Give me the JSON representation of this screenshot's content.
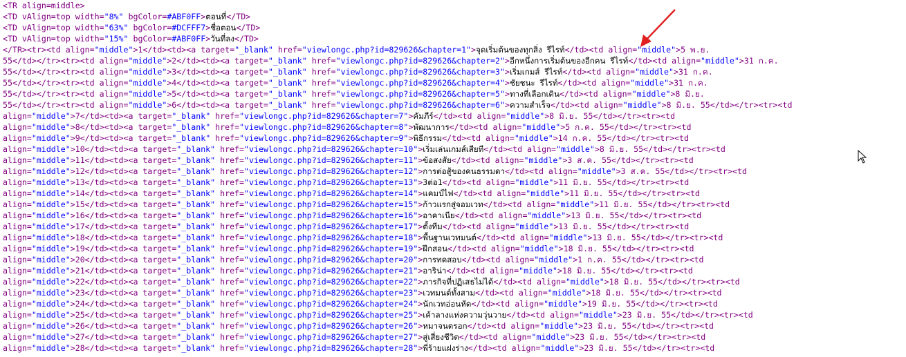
{
  "header_lines": [
    [
      [
        "t",
        "<TR align=middle>"
      ]
    ],
    [
      [
        "t",
        "<TD vAlign=top width="
      ],
      [
        "v",
        "\"8%\""
      ],
      [
        "t",
        " bgColor="
      ],
      [
        "v",
        "#ABF0FF"
      ],
      [
        "t",
        ">"
      ],
      [
        "x",
        "ตอนที่"
      ],
      [
        "t",
        "</TD>"
      ]
    ],
    [
      [
        "t",
        "<TD vAlign=top width="
      ],
      [
        "v",
        "\"63%\""
      ],
      [
        "t",
        " bgColor="
      ],
      [
        "v",
        "#DCFFF7"
      ],
      [
        "t",
        ">"
      ],
      [
        "x",
        "ชื่อตอน"
      ],
      [
        "t",
        "</TD>"
      ]
    ],
    [
      [
        "t",
        "<TD vAlign=top width="
      ],
      [
        "v",
        "\"15%\""
      ],
      [
        "t",
        " bgColor="
      ],
      [
        "v",
        "#ABF0FF"
      ],
      [
        "t",
        ">"
      ],
      [
        "x",
        "วันที่ลง"
      ],
      [
        "t",
        "</TD>"
      ]
    ]
  ],
  "body_lines": [
    [
      [
        "t",
        "</TR><tr><td align="
      ],
      [
        "v",
        "\"middle\""
      ],
      [
        "t",
        ">1</td><td><a target="
      ],
      [
        "v",
        "\"_blank\""
      ],
      [
        "t",
        " href="
      ],
      [
        "v",
        "\"viewlongc.php?id=829626&chapter=1\""
      ],
      [
        "t",
        ">"
      ],
      [
        "x",
        "จุดเริ่มต้นของทุกสิ่ง รีไรท์"
      ],
      [
        "t",
        "</td><td align="
      ],
      [
        "v",
        "\"middle\""
      ],
      [
        "t",
        ">5 พ.ย."
      ]
    ],
    [
      [
        "t",
        "55</td></tr><tr><td align="
      ],
      [
        "v",
        "\"middle\""
      ],
      [
        "t",
        ">2</td><td><a target="
      ],
      [
        "v",
        "\"_blank\""
      ],
      [
        "t",
        " href="
      ],
      [
        "v",
        "\"viewlongc.php?id=829626&chapter=2\""
      ],
      [
        "t",
        ">"
      ],
      [
        "x",
        "อีกหนึ่งการเริ่มต้นของอีกคน รีไรท์"
      ],
      [
        "t",
        "</td><td align="
      ],
      [
        "v",
        "\"middle\""
      ],
      [
        "t",
        ">31 ก.ค."
      ]
    ],
    [
      [
        "t",
        "55</td></tr><tr><td align="
      ],
      [
        "v",
        "\"middle\""
      ],
      [
        "t",
        ">3</td><td><a target="
      ],
      [
        "v",
        "\"_blank\""
      ],
      [
        "t",
        " href="
      ],
      [
        "v",
        "\"viewlongc.php?id=829626&chapter=3\""
      ],
      [
        "t",
        ">"
      ],
      [
        "x",
        "เริ่มเกมส์ รีไรท์"
      ],
      [
        "t",
        "</td><td align="
      ],
      [
        "v",
        "\"middle\""
      ],
      [
        "t",
        ">31 ก.ค."
      ]
    ],
    [
      [
        "t",
        "55</td></tr><tr><td align="
      ],
      [
        "v",
        "\"middle\""
      ],
      [
        "t",
        ">4</td><td><a target="
      ],
      [
        "v",
        "\"_blank\""
      ],
      [
        "t",
        " href="
      ],
      [
        "v",
        "\"viewlongc.php?id=829626&chapter=4\""
      ],
      [
        "t",
        ">"
      ],
      [
        "x",
        "ชัยชนะ รีไรท์"
      ],
      [
        "t",
        "</td><td align="
      ],
      [
        "v",
        "\"middle\""
      ],
      [
        "t",
        ">31 ก.ค."
      ]
    ],
    [
      [
        "t",
        "55</td></tr><tr><td align="
      ],
      [
        "v",
        "\"middle\""
      ],
      [
        "t",
        ">5</td><td><a target="
      ],
      [
        "v",
        "\"_blank\""
      ],
      [
        "t",
        " href="
      ],
      [
        "v",
        "\"viewlongc.php?id=829626&chapter=5\""
      ],
      [
        "t",
        ">"
      ],
      [
        "x",
        "ทางที่เลือกเดิน"
      ],
      [
        "t",
        "</td><td align="
      ],
      [
        "v",
        "\"middle\""
      ],
      [
        "t",
        ">8 มิ.ย."
      ]
    ],
    [
      [
        "t",
        "55</td></tr><tr><td align="
      ],
      [
        "v",
        "\"middle\""
      ],
      [
        "t",
        ">6</td><td><a target="
      ],
      [
        "v",
        "\"_blank\""
      ],
      [
        "t",
        " href="
      ],
      [
        "v",
        "\"viewlongc.php?id=829626&chapter=6\""
      ],
      [
        "t",
        ">"
      ],
      [
        "x",
        "ความสำเร็จ"
      ],
      [
        "t",
        "</td><td align="
      ],
      [
        "v",
        "\"middle\""
      ],
      [
        "t",
        ">8 มิ.ย. 55</td></tr><tr><td"
      ]
    ],
    [
      [
        "t",
        "align="
      ],
      [
        "v",
        "\"middle\""
      ],
      [
        "t",
        ">7</td><td><a target="
      ],
      [
        "v",
        "\"_blank\""
      ],
      [
        "t",
        " href="
      ],
      [
        "v",
        "\"viewlongc.php?id=829626&chapter=7\""
      ],
      [
        "t",
        ">"
      ],
      [
        "x",
        "คัมภีร์"
      ],
      [
        "t",
        "</td><td align="
      ],
      [
        "v",
        "\"middle\""
      ],
      [
        "t",
        ">8 มิ.ย. 55</td></tr><tr><td"
      ]
    ],
    [
      [
        "t",
        "align="
      ],
      [
        "v",
        "\"middle\""
      ],
      [
        "t",
        ">8</td><td><a target="
      ],
      [
        "v",
        "\"_blank\""
      ],
      [
        "t",
        " href="
      ],
      [
        "v",
        "\"viewlongc.php?id=829626&chapter=8\""
      ],
      [
        "t",
        ">"
      ],
      [
        "x",
        "พัฒนาการ"
      ],
      [
        "t",
        "</td><td align="
      ],
      [
        "v",
        "\"middle\""
      ],
      [
        "t",
        ">5 ก.ค. 55</td></tr><tr><td"
      ]
    ],
    [
      [
        "t",
        "align="
      ],
      [
        "v",
        "\"middle\""
      ],
      [
        "t",
        ">9</td><td><a target="
      ],
      [
        "v",
        "\"_blank\""
      ],
      [
        "t",
        " href="
      ],
      [
        "v",
        "\"viewlongc.php?id=829626&chapter=9\""
      ],
      [
        "t",
        ">"
      ],
      [
        "x",
        "พิธีกรรม"
      ],
      [
        "t",
        "</td><td align="
      ],
      [
        "v",
        "\"middle\""
      ],
      [
        "t",
        ">14 ก.ค. 55</td></tr><tr><td"
      ]
    ],
    [
      [
        "t",
        "align="
      ],
      [
        "v",
        "\"middle\""
      ],
      [
        "t",
        ">10</td><td><a target="
      ],
      [
        "v",
        "\"_blank\""
      ],
      [
        "t",
        " href="
      ],
      [
        "v",
        "\"viewlongc.php?id=829626&chapter=10\""
      ],
      [
        "t",
        ">"
      ],
      [
        "x",
        "เริ่มเล่นเกมส์เสียที"
      ],
      [
        "t",
        "</td><td align="
      ],
      [
        "v",
        "\"middle\""
      ],
      [
        "t",
        ">8 มิ.ย. 55</td></tr><tr><td"
      ]
    ],
    [
      [
        "t",
        "align="
      ],
      [
        "v",
        "\"middle\""
      ],
      [
        "t",
        ">11</td><td><a target="
      ],
      [
        "v",
        "\"_blank\""
      ],
      [
        "t",
        " href="
      ],
      [
        "v",
        "\"viewlongc.php?id=829626&chapter=11\""
      ],
      [
        "t",
        ">"
      ],
      [
        "x",
        "ข้อสงสัย"
      ],
      [
        "t",
        "</td><td align="
      ],
      [
        "v",
        "\"middle\""
      ],
      [
        "t",
        ">3 ส.ค. 55</td></tr><tr><td"
      ]
    ],
    [
      [
        "t",
        "align="
      ],
      [
        "v",
        "\"middle\""
      ],
      [
        "t",
        ">12</td><td><a target="
      ],
      [
        "v",
        "\"_blank\""
      ],
      [
        "t",
        " href="
      ],
      [
        "v",
        "\"viewlongc.php?id=829626&chapter=12\""
      ],
      [
        "t",
        ">"
      ],
      [
        "x",
        "การต่อสู้ของคนธรรมดา"
      ],
      [
        "t",
        "</td><td align="
      ],
      [
        "v",
        "\"middle\""
      ],
      [
        "t",
        ">3 ส.ค. 55</td></tr><tr><td"
      ]
    ],
    [
      [
        "t",
        "align="
      ],
      [
        "v",
        "\"middle\""
      ],
      [
        "t",
        ">13</td><td><a target="
      ],
      [
        "v",
        "\"_blank\""
      ],
      [
        "t",
        " href="
      ],
      [
        "v",
        "\"viewlongc.php?id=829626&chapter=13\""
      ],
      [
        "t",
        ">"
      ],
      [
        "x",
        "3ต่อ1"
      ],
      [
        "t",
        "</td><td align="
      ],
      [
        "v",
        "\"middle\""
      ],
      [
        "t",
        ">11 มิ.ย. 55</td></tr><tr><td"
      ]
    ],
    [
      [
        "t",
        "align="
      ],
      [
        "v",
        "\"middle\""
      ],
      [
        "t",
        ">14</td><td><a target="
      ],
      [
        "v",
        "\"_blank\""
      ],
      [
        "t",
        " href="
      ],
      [
        "v",
        "\"viewlongc.php?id=829626&chapter=14\""
      ],
      [
        "t",
        ">"
      ],
      [
        "x",
        "แคมป์ไฟ"
      ],
      [
        "t",
        "</td><td align="
      ],
      [
        "v",
        "\"middle\""
      ],
      [
        "t",
        ">11 มิ.ย. 55</td></tr><tr><td"
      ]
    ],
    [
      [
        "t",
        "align="
      ],
      [
        "v",
        "\"middle\""
      ],
      [
        "t",
        ">15</td><td><a target="
      ],
      [
        "v",
        "\"_blank\""
      ],
      [
        "t",
        " href="
      ],
      [
        "v",
        "\"viewlongc.php?id=829626&chapter=15\""
      ],
      [
        "t",
        ">"
      ],
      [
        "x",
        "ก้าวแรกสู่จอมเวท"
      ],
      [
        "t",
        "</td><td align="
      ],
      [
        "v",
        "\"middle\""
      ],
      [
        "t",
        ">11 มิ.ย. 55</td></tr><tr><td"
      ]
    ],
    [
      [
        "t",
        "align="
      ],
      [
        "v",
        "\"middle\""
      ],
      [
        "t",
        ">16</td><td><a target="
      ],
      [
        "v",
        "\"_blank\""
      ],
      [
        "t",
        " href="
      ],
      [
        "v",
        "\"viewlongc.php?id=829626&chapter=16\""
      ],
      [
        "t",
        ">"
      ],
      [
        "x",
        "อาคาเนีย"
      ],
      [
        "t",
        "</td><td align="
      ],
      [
        "v",
        "\"middle\""
      ],
      [
        "t",
        ">13 มิ.ย. 55</td></tr><tr><td"
      ]
    ],
    [
      [
        "t",
        "align="
      ],
      [
        "v",
        "\"middle\""
      ],
      [
        "t",
        ">17</td><td><a target="
      ],
      [
        "v",
        "\"_blank\""
      ],
      [
        "t",
        " href="
      ],
      [
        "v",
        "\"viewlongc.php?id=829626&chapter=17\""
      ],
      [
        "t",
        ">"
      ],
      [
        "x",
        "ตั้งทีม"
      ],
      [
        "t",
        "</td><td align="
      ],
      [
        "v",
        "\"middle\""
      ],
      [
        "t",
        ">13 มิ.ย. 55</td></tr><tr><td"
      ]
    ],
    [
      [
        "t",
        "align="
      ],
      [
        "v",
        "\"middle\""
      ],
      [
        "t",
        ">18</td><td><a target="
      ],
      [
        "v",
        "\"_blank\""
      ],
      [
        "t",
        " href="
      ],
      [
        "v",
        "\"viewlongc.php?id=829626&chapter=18\""
      ],
      [
        "t",
        ">"
      ],
      [
        "x",
        "พื้นฐานเวทมนต์"
      ],
      [
        "t",
        "</td><td align="
      ],
      [
        "v",
        "\"middle\""
      ],
      [
        "t",
        ">13 มิ.ย. 55</td></tr><tr><td"
      ]
    ],
    [
      [
        "t",
        "align="
      ],
      [
        "v",
        "\"middle\""
      ],
      [
        "t",
        ">19</td><td><a target="
      ],
      [
        "v",
        "\"_blank\""
      ],
      [
        "t",
        " href="
      ],
      [
        "v",
        "\"viewlongc.php?id=829626&chapter=19\""
      ],
      [
        "t",
        ">"
      ],
      [
        "x",
        "ฝึกสอน"
      ],
      [
        "t",
        "</td><td align="
      ],
      [
        "v",
        "\"middle\""
      ],
      [
        "t",
        ">18 มิ.ย. 55</td></tr><tr><td"
      ]
    ],
    [
      [
        "t",
        "align="
      ],
      [
        "v",
        "\"middle\""
      ],
      [
        "t",
        ">20</td><td><a target="
      ],
      [
        "v",
        "\"_blank\""
      ],
      [
        "t",
        " href="
      ],
      [
        "v",
        "\"viewlongc.php?id=829626&chapter=20\""
      ],
      [
        "t",
        ">"
      ],
      [
        "x",
        "การทดสอบ"
      ],
      [
        "t",
        "</td><td align="
      ],
      [
        "v",
        "\"middle\""
      ],
      [
        "t",
        ">1 ก.ค. 55</td></tr><tr><td"
      ]
    ],
    [
      [
        "t",
        "align="
      ],
      [
        "v",
        "\"middle\""
      ],
      [
        "t",
        ">21</td><td><a target="
      ],
      [
        "v",
        "\"_blank\""
      ],
      [
        "t",
        " href="
      ],
      [
        "v",
        "\"viewlongc.php?id=829626&chapter=21\""
      ],
      [
        "t",
        ">"
      ],
      [
        "x",
        "อาริน่า"
      ],
      [
        "t",
        "</td><td align="
      ],
      [
        "v",
        "\"middle\""
      ],
      [
        "t",
        ">18 มิ.ย. 55</td></tr><tr><td"
      ]
    ],
    [
      [
        "t",
        "align="
      ],
      [
        "v",
        "\"middle\""
      ],
      [
        "t",
        ">22</td><td><a target="
      ],
      [
        "v",
        "\"_blank\""
      ],
      [
        "t",
        " href="
      ],
      [
        "v",
        "\"viewlongc.php?id=829626&chapter=22\""
      ],
      [
        "t",
        ">"
      ],
      [
        "x",
        "ภารกิจที่ปฏิเสธไม่ได้"
      ],
      [
        "t",
        "</td><td align="
      ],
      [
        "v",
        "\"middle\""
      ],
      [
        "t",
        ">18 มิ.ย. 55</td></tr><tr><td"
      ]
    ],
    [
      [
        "t",
        "align="
      ],
      [
        "v",
        "\"middle\""
      ],
      [
        "t",
        ">23</td><td><a target="
      ],
      [
        "v",
        "\"_blank\""
      ],
      [
        "t",
        " href="
      ],
      [
        "v",
        "\"viewlongc.php?id=829626&chapter=23\""
      ],
      [
        "t",
        ">"
      ],
      [
        "x",
        "เวทมนต์ทั้งสาม"
      ],
      [
        "t",
        "</td><td align="
      ],
      [
        "v",
        "\"middle\""
      ],
      [
        "t",
        ">18 มิ.ย. 55</td></tr><tr><td"
      ]
    ],
    [
      [
        "t",
        "align="
      ],
      [
        "v",
        "\"middle\""
      ],
      [
        "t",
        ">24</td><td><a target="
      ],
      [
        "v",
        "\"_blank\""
      ],
      [
        "t",
        " href="
      ],
      [
        "v",
        "\"viewlongc.php?id=829626&chapter=24\""
      ],
      [
        "t",
        ">"
      ],
      [
        "x",
        "นักเวทอ่อนหัด"
      ],
      [
        "t",
        "</td><td align="
      ],
      [
        "v",
        "\"middle\""
      ],
      [
        "t",
        ">19 มิ.ย. 55</td></tr><tr><td"
      ]
    ],
    [
      [
        "t",
        "align="
      ],
      [
        "v",
        "\"middle\""
      ],
      [
        "t",
        ">25</td><td><a target="
      ],
      [
        "v",
        "\"_blank\""
      ],
      [
        "t",
        " href="
      ],
      [
        "v",
        "\"viewlongc.php?id=829626&chapter=25\""
      ],
      [
        "t",
        ">"
      ],
      [
        "x",
        "เค้าลางแห่งความวุ่นวาย"
      ],
      [
        "t",
        "</td><td align="
      ],
      [
        "v",
        "\"middle\""
      ],
      [
        "t",
        ">23 มิ.ย. 55</td></tr><tr><td"
      ]
    ],
    [
      [
        "t",
        "align="
      ],
      [
        "v",
        "\"middle\""
      ],
      [
        "t",
        ">26</td><td><a target="
      ],
      [
        "v",
        "\"_blank\""
      ],
      [
        "t",
        " href="
      ],
      [
        "v",
        "\"viewlongc.php?id=829626&chapter=26\""
      ],
      [
        "t",
        ">"
      ],
      [
        "x",
        "หมาจนตรอก"
      ],
      [
        "t",
        "</td><td align="
      ],
      [
        "v",
        "\"middle\""
      ],
      [
        "t",
        ">23 มิ.ย. 55</td></tr><tr><td"
      ]
    ],
    [
      [
        "t",
        "align="
      ],
      [
        "v",
        "\"middle\""
      ],
      [
        "t",
        ">27</td><td><a target="
      ],
      [
        "v",
        "\"_blank\""
      ],
      [
        "t",
        " href="
      ],
      [
        "v",
        "\"viewlongc.php?id=829626&chapter=27\""
      ],
      [
        "t",
        ">"
      ],
      [
        "x",
        "สู่เสี่ยงชีวิต"
      ],
      [
        "t",
        "</td><td align="
      ],
      [
        "v",
        "\"middle\""
      ],
      [
        "t",
        ">23 มิ.ย. 55</td></tr><tr><td"
      ]
    ],
    [
      [
        "t",
        "align="
      ],
      [
        "v",
        "\"middle\""
      ],
      [
        "t",
        ">28</td><td><a target="
      ],
      [
        "v",
        "\"_blank\""
      ],
      [
        "t",
        " href="
      ],
      [
        "v",
        "\"viewlongc.php?id=829626&chapter=28\""
      ],
      [
        "t",
        ">"
      ],
      [
        "x",
        "พี่ร้ายแฝงร่าง"
      ],
      [
        "t",
        "</td><td align="
      ],
      [
        "v",
        "\"middle\""
      ],
      [
        "t",
        ">23 มิ.ย. 55</td></tr><tr><td"
      ]
    ]
  ],
  "colors": {
    "tag": "#800080",
    "value": "#0000ff",
    "text": "#000000",
    "annotation_arrow": "#e02020"
  },
  "icons": {
    "annotation": "red-arrow-icon",
    "pointer": "mouse-cursor-icon"
  }
}
